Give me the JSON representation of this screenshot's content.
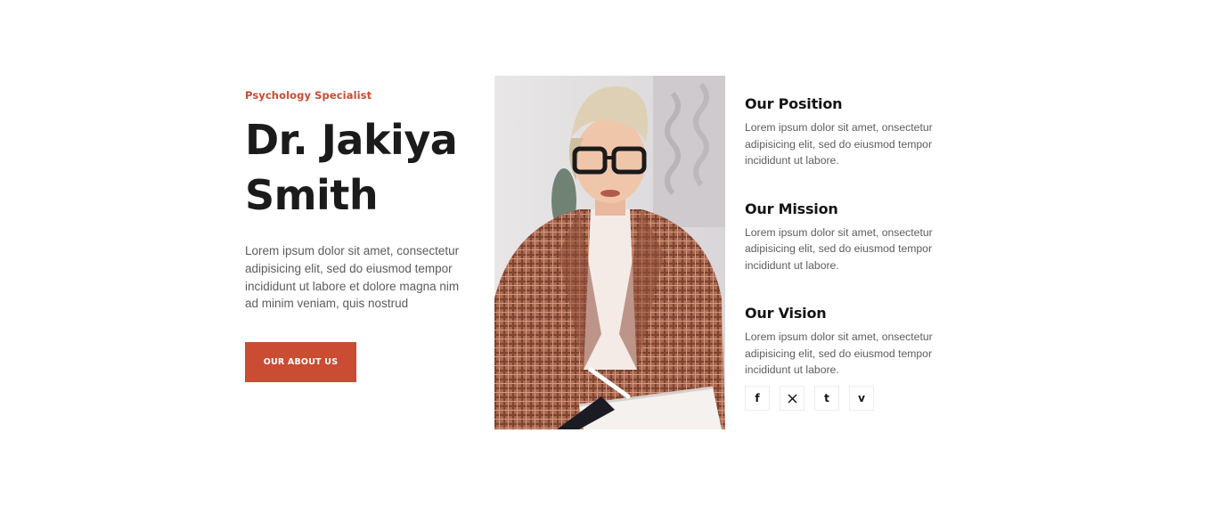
{
  "hero": {
    "eyebrow": "Psychology Specialist",
    "name_line1": "Dr. Jakiya",
    "name_line2": "Smith",
    "intro": "Lorem ipsum dolor sit amet, consectetur adipisicing elit, sed do eiusmod tempor incididunt ut labore et dolore magna nim ad minim veniam, quis nostrud",
    "cta_label": "OUR ABOUT US"
  },
  "colors": {
    "accent": "#c94c33",
    "heading": "#1b1b1b",
    "body": "#5c5c5c"
  },
  "sections": [
    {
      "title": "Our Position",
      "text": "Lorem ipsum dolor sit amet, onsectetur adipisicing elit, sed do eiusmod tempor incididunt ut labore."
    },
    {
      "title": "Our Mission",
      "text": "Lorem ipsum dolor sit amet, onsectetur adipisicing elit, sed do eiusmod tempor incididunt ut labore."
    },
    {
      "title": "Our Vision",
      "text": "Lorem ipsum dolor sit amet, onsectetur adipisicing elit, sed do eiusmod tempor incididunt ut labore."
    }
  ],
  "social": [
    {
      "icon": "facebook-icon",
      "glyph": "f"
    },
    {
      "icon": "x-twitter-icon",
      "glyph": "𝕏"
    },
    {
      "icon": "tumblr-icon",
      "glyph": "t"
    },
    {
      "icon": "vimeo-icon",
      "glyph": "v"
    }
  ]
}
